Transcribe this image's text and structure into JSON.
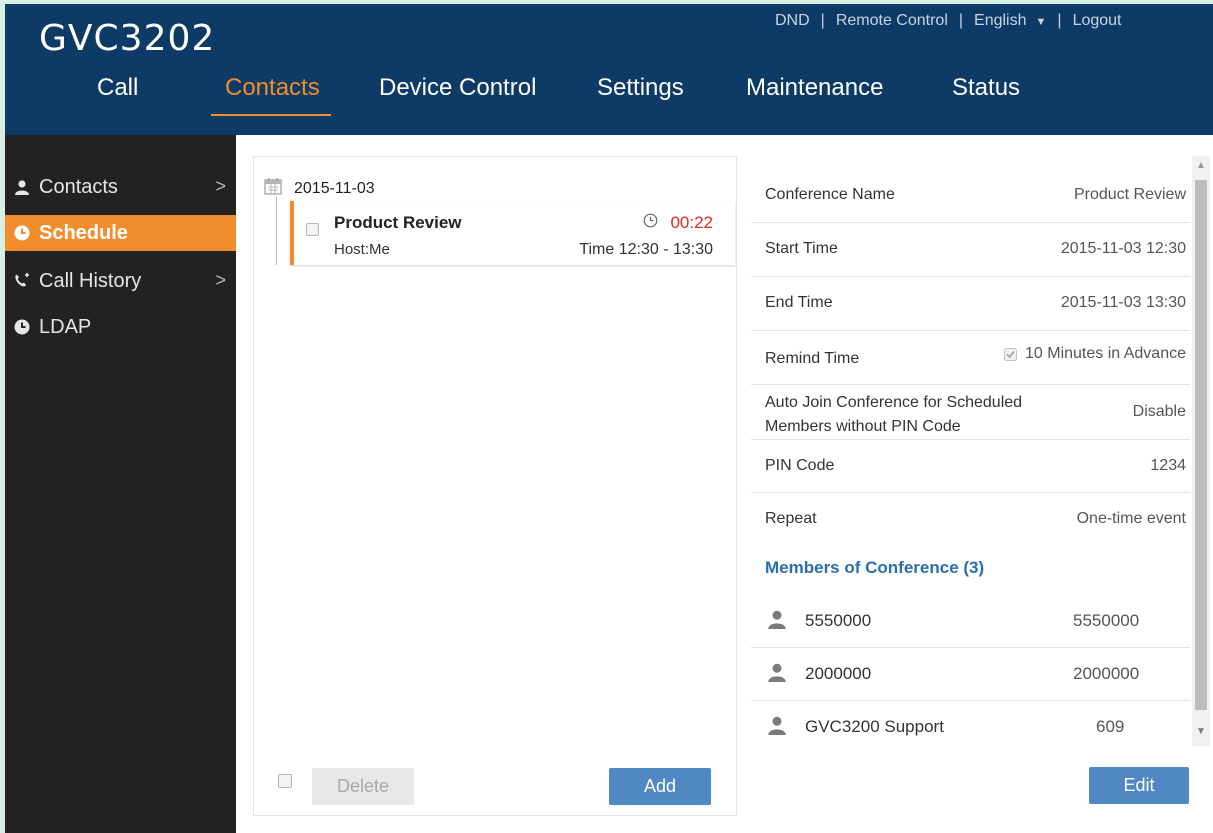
{
  "app": {
    "title": "GVC3202"
  },
  "top_links": {
    "dnd": "DND",
    "remote": "Remote Control",
    "language": "English",
    "logout": "Logout",
    "separator": "|"
  },
  "nav": {
    "call": "Call",
    "contacts": "Contacts",
    "device_control": "Device Control",
    "settings": "Settings",
    "maintenance": "Maintenance",
    "status": "Status"
  },
  "sidebar": {
    "items": [
      {
        "label": "Contacts",
        "icon": "person-icon",
        "has_arrow": true
      },
      {
        "label": "Schedule",
        "icon": "clock-icon",
        "active": true
      },
      {
        "label": "Call History",
        "icon": "phone-icon",
        "has_arrow": true
      },
      {
        "label": "LDAP",
        "icon": "clock-icon"
      }
    ],
    "arrow": ">"
  },
  "schedule_list": {
    "date": "2015-11-03",
    "event": {
      "title": "Product Review",
      "host": "Host:Me",
      "countdown": "00:22",
      "time": "Time 12:30 - 13:30"
    },
    "delete_label": "Delete",
    "add_label": "Add"
  },
  "details": {
    "rows": [
      {
        "label": "Conference Name",
        "value": "Product Review"
      },
      {
        "label": "Start Time",
        "value": "2015-11-03 12:30"
      },
      {
        "label": "End Time",
        "value": "2015-11-03 13:30"
      },
      {
        "label": "Remind Time",
        "value": "10 Minutes in Advance"
      },
      {
        "label_line1": "Auto Join Conference for Scheduled",
        "label_line2": "Members without PIN Code",
        "value": "Disable"
      },
      {
        "label": "PIN Code",
        "value": "1234"
      },
      {
        "label": "Repeat",
        "value": "One-time event"
      }
    ],
    "members_title": "Members of Conference (3)",
    "members": [
      {
        "name": "5550000",
        "number": "5550000"
      },
      {
        "name": "2000000",
        "number": "2000000"
      },
      {
        "name": "GVC3200 Support",
        "number": "609"
      }
    ],
    "edit_label": "Edit"
  },
  "colors": {
    "header": "#0e3b66",
    "accent": "#f18d2c",
    "button": "#4f88c3",
    "countdown": "#e02b20",
    "sidebar": "#222222"
  }
}
